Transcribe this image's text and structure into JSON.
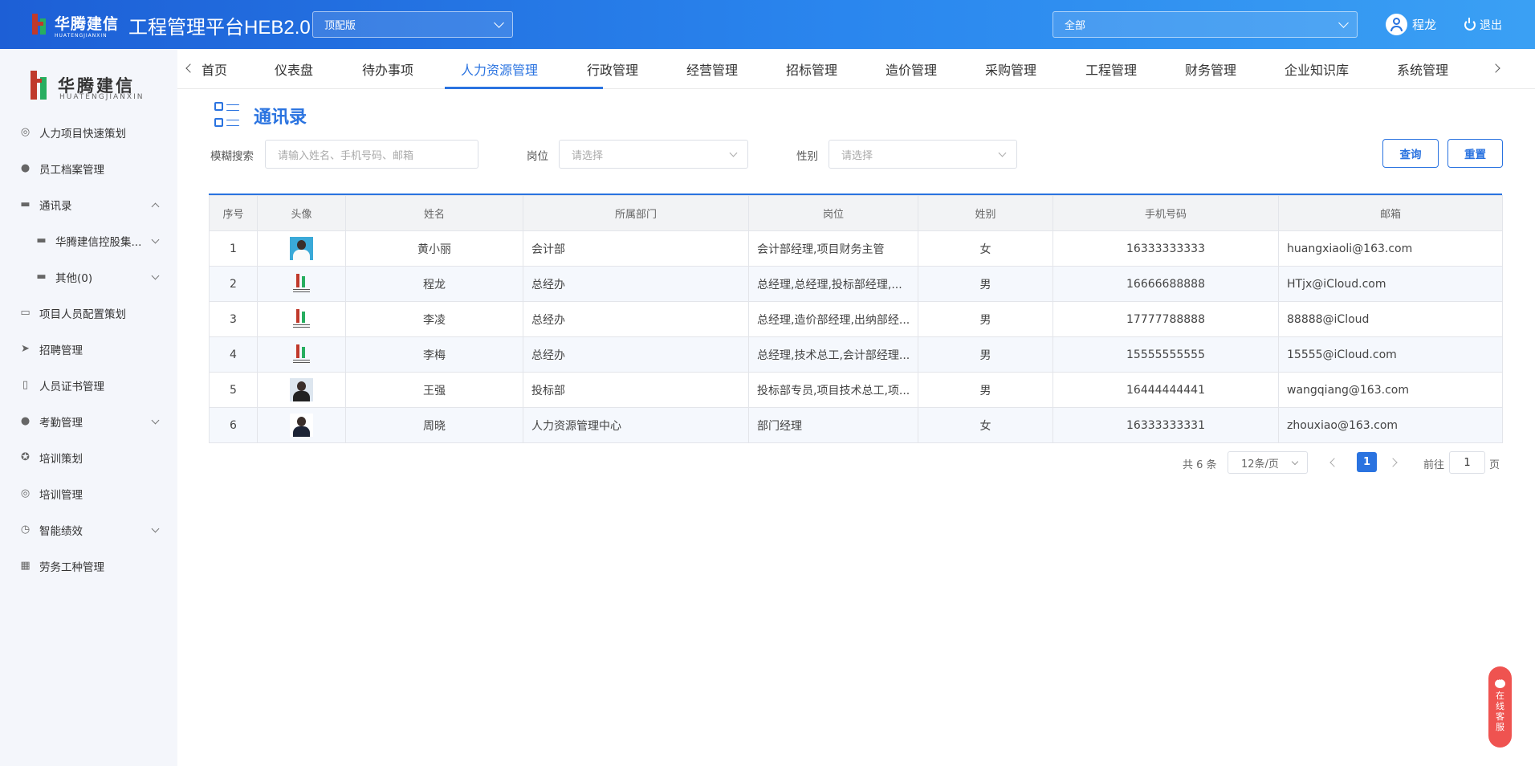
{
  "header": {
    "logo_text": "华腾建信",
    "logo_sub": "HUATENGJIANXIN",
    "title": "工程管理平台HEB2.0",
    "edition_select": "顶配版",
    "scope_select": "全部",
    "user_name": "程龙",
    "logout_label": "退出"
  },
  "sidebar": {
    "logo_text": "华腾建信",
    "logo_sub": "HUATENGJIANXIN",
    "items": [
      {
        "label": "人力项目快速策划",
        "icon": "check-circle-icon"
      },
      {
        "label": "员工档案管理",
        "icon": "person-icon"
      },
      {
        "label": "通讯录",
        "icon": "briefcase-icon",
        "expanded": true
      },
      {
        "label": "华腾建信控股集...",
        "icon": "briefcase-icon",
        "sub": true
      },
      {
        "label": "其他(0)",
        "icon": "briefcase-icon",
        "sub": true
      },
      {
        "label": "项目人员配置策划",
        "icon": "monitor-icon"
      },
      {
        "label": "招聘管理",
        "icon": "send-icon"
      },
      {
        "label": "人员证书管理",
        "icon": "certificate-icon"
      },
      {
        "label": "考勤管理",
        "icon": "person-icon"
      },
      {
        "label": "培训策划",
        "icon": "lifebuoy-icon"
      },
      {
        "label": "培训管理",
        "icon": "target-icon"
      },
      {
        "label": "智能绩效",
        "icon": "stopwatch-icon"
      },
      {
        "label": "劳务工种管理",
        "icon": "grid-icon"
      }
    ]
  },
  "nav": {
    "tabs": [
      "首页",
      "仪表盘",
      "待办事项",
      "人力资源管理",
      "行政管理",
      "经营管理",
      "招标管理",
      "造价管理",
      "采购管理",
      "工程管理",
      "财务管理",
      "企业知识库",
      "系统管理"
    ],
    "active_index": 3
  },
  "page": {
    "title": "通讯录"
  },
  "filters": {
    "search_label": "模糊搜索",
    "search_placeholder": "请输入姓名、手机号码、邮箱",
    "post_label": "岗位",
    "post_placeholder": "请选择",
    "gender_label": "性别",
    "gender_placeholder": "请选择",
    "query_button": "查询",
    "reset_button": "重置"
  },
  "table": {
    "columns": [
      "序号",
      "头像",
      "姓名",
      "所属部门",
      "岗位",
      "姓别",
      "手机号码",
      "邮箱"
    ],
    "rows": [
      {
        "no": "1",
        "avatar": "photo",
        "name": "黄小丽",
        "dept": "会计部",
        "post": "会计部经理,项目财务主管",
        "gender": "女",
        "phone": "16333333333",
        "email": "huangxiaoli@163.com"
      },
      {
        "no": "2",
        "avatar": "logo",
        "name": "程龙",
        "dept": "总经办",
        "post": "总经理,总经理,投标部经理,...",
        "gender": "男",
        "phone": "16666688888",
        "email": "HTjx@iCloud.com"
      },
      {
        "no": "3",
        "avatar": "logo",
        "name": "李凌",
        "dept": "总经办",
        "post": "总经理,造价部经理,出纳部经...",
        "gender": "男",
        "phone": "17777788888",
        "email": "88888@iCloud"
      },
      {
        "no": "4",
        "avatar": "logo",
        "name": "李梅",
        "dept": "总经办",
        "post": "总经理,技术总工,会计部经理...",
        "gender": "男",
        "phone": "15555555555",
        "email": "15555@iCloud.com"
      },
      {
        "no": "5",
        "avatar": "photo",
        "name": "王强",
        "dept": "投标部",
        "post": "投标部专员,项目技术总工,项...",
        "gender": "男",
        "phone": "16444444441",
        "email": "wangqiang@163.com"
      },
      {
        "no": "6",
        "avatar": "photo",
        "name": "周晓",
        "dept": "人力资源管理中心",
        "post": "部门经理",
        "gender": "女",
        "phone": "16333333331",
        "email": "zhouxiao@163.com"
      }
    ]
  },
  "pagination": {
    "total": "共 6 条",
    "page_size": "12条/页",
    "current": "1",
    "goto_label": "前往",
    "goto_value": "1",
    "page_unit": "页"
  },
  "service": {
    "label": [
      "在",
      "线",
      "客",
      "服"
    ]
  },
  "colors": {
    "primary": "#2a73e0",
    "service": "#ef5350"
  }
}
